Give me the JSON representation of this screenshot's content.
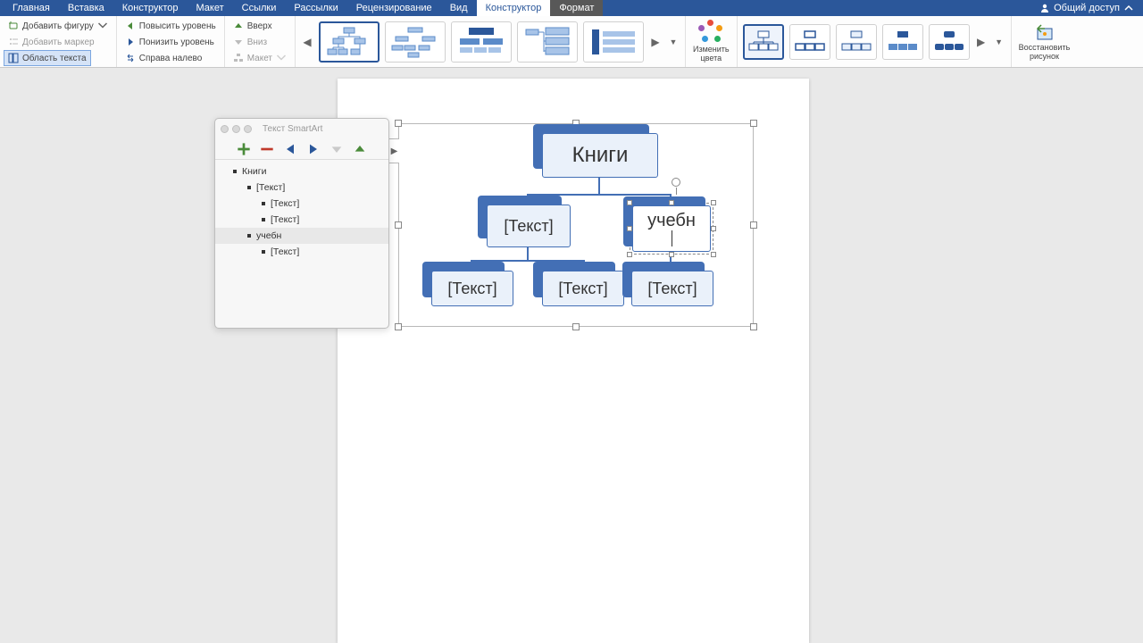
{
  "tabs": {
    "items": [
      "Главная",
      "Вставка",
      "Конструктор",
      "Макет",
      "Ссылки",
      "Рассылки",
      "Рецензирование",
      "Вид",
      "Конструктор",
      "Формат"
    ],
    "active_index": 8,
    "format_index": 9
  },
  "share": {
    "label": "Общий доступ"
  },
  "ribbon": {
    "group1": {
      "add_shape": "Добавить фигуру",
      "add_bullet": "Добавить маркер",
      "text_pane": "Область текста"
    },
    "group2": {
      "promote": "Повысить уровень",
      "demote": "Понизить уровень",
      "rtl": "Справа налево"
    },
    "group3": {
      "up": "Вверх",
      "down": "Вниз",
      "layout": "Макет"
    },
    "change_colors": {
      "line1": "Изменить",
      "line2": "цвета"
    },
    "reset": {
      "line1": "Восстановить",
      "line2": "рисунок"
    }
  },
  "text_panel": {
    "title": "Текст SmartArt",
    "items": [
      {
        "text": "Книги",
        "indent": 1,
        "sel": false
      },
      {
        "text": "[Текст]",
        "indent": 2,
        "sel": false
      },
      {
        "text": "[Текст]",
        "indent": 3,
        "sel": false
      },
      {
        "text": "[Текст]",
        "indent": 3,
        "sel": false
      },
      {
        "text": "учебн",
        "indent": 2,
        "sel": true
      },
      {
        "text": "[Текст]",
        "indent": 3,
        "sel": false
      }
    ]
  },
  "smartart": {
    "root": "Книги",
    "mid_left": "[Текст]",
    "mid_right": "учебн",
    "leaf1": "[Текст]",
    "leaf2": "[Текст]",
    "leaf3": "[Текст]"
  }
}
